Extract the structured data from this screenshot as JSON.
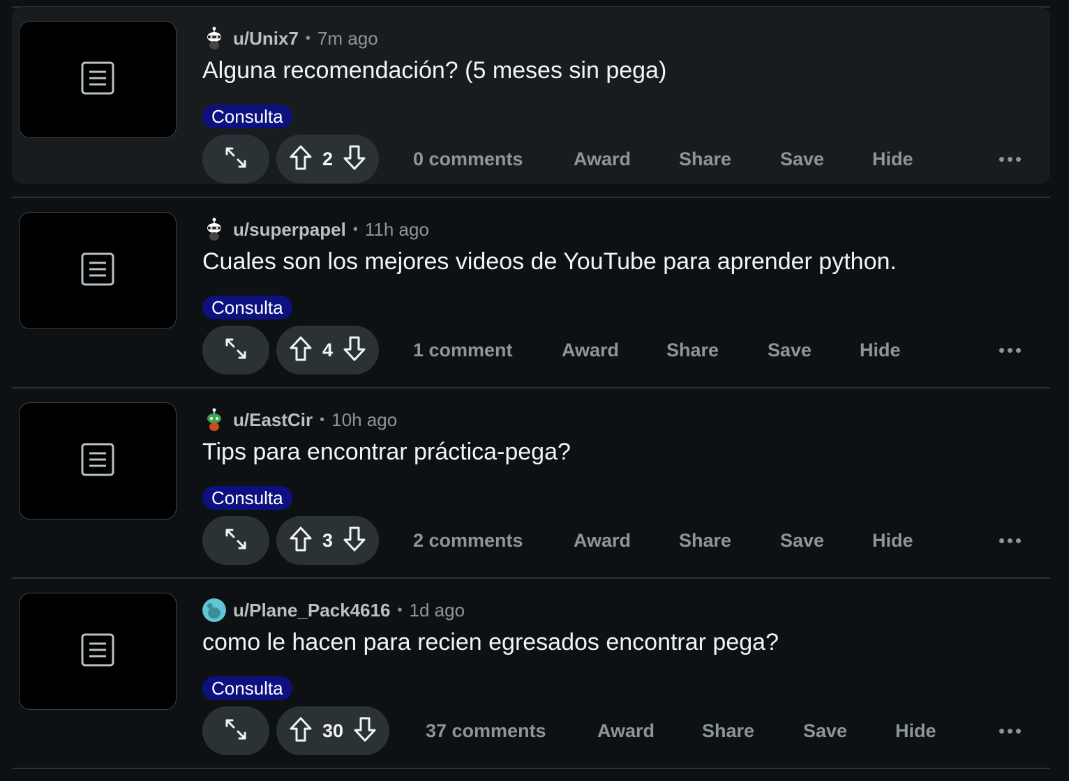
{
  "feed": {
    "posts": [
      {
        "author": "u/Unix7",
        "separator": "•",
        "time": "7m ago",
        "title": "Alguna recomendación? (5 meses sin pega)",
        "flair": "Consulta",
        "score": "2",
        "comments": "0 comments",
        "award": "Award",
        "share": "Share",
        "save": "Save",
        "hide": "Hide",
        "avatar_icon": "snoo-avatar-icon",
        "hovered": true
      },
      {
        "author": "u/superpapel",
        "separator": "•",
        "time": "11h ago",
        "title": "Cuales son los mejores videos de YouTube para aprender python.",
        "flair": "Consulta",
        "score": "4",
        "comments": "1 comment",
        "award": "Award",
        "share": "Share",
        "save": "Save",
        "hide": "Hide",
        "avatar_icon": "snoo-avatar-icon",
        "hovered": false
      },
      {
        "author": "u/EastCir",
        "separator": "•",
        "time": "10h ago",
        "title": "Tips para encontrar práctica-pega?",
        "flair": "Consulta",
        "score": "3",
        "comments": "2 comments",
        "award": "Award",
        "share": "Share",
        "save": "Save",
        "hide": "Hide",
        "avatar_icon": "snoo-avatar-icon",
        "hovered": false
      },
      {
        "author": "u/Plane_Pack4616",
        "separator": "•",
        "time": "1d ago",
        "title": "como le hacen para recien egresados encontrar pega?",
        "flair": "Consulta",
        "score": "30",
        "comments": "37 comments",
        "award": "Award",
        "share": "Share",
        "save": "Save",
        "hide": "Hide",
        "avatar_icon": "default-avatar-icon",
        "hovered": false
      }
    ]
  },
  "colors": {
    "background": "#0e1113",
    "hover_row": "#181c1f",
    "pill": "#2a3236",
    "flair_bg": "#0d1180",
    "muted_text": "#8b969c",
    "title_text": "#f2f4f5"
  }
}
